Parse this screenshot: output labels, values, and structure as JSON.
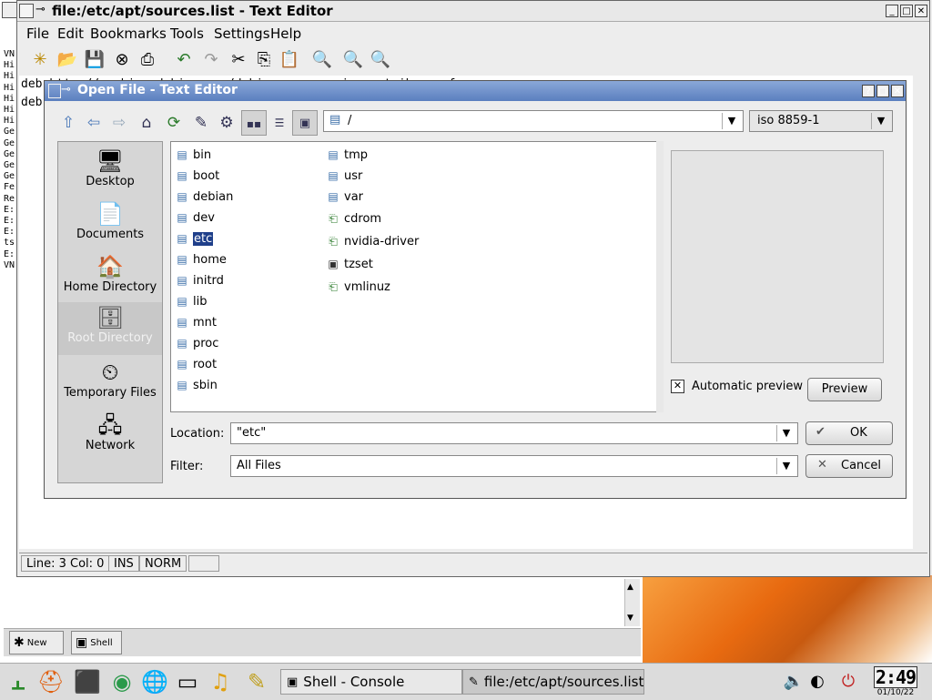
{
  "konsole": {
    "left_lines": "VN\nHi\nHi\nHi\nHi\nHi\nHi\nGe\nGe\nGe\nGe\nGe\nFe\nRe\nE:\nE:\nE:\nts\nE:\nVN",
    "tabs": [
      {
        "label": "New"
      },
      {
        "label": "Shell"
      }
    ]
  },
  "editor": {
    "title": "file:/etc/apt/sources.list - Text Editor",
    "menu": [
      "File",
      "Edit",
      "Bookmarks",
      "Tools",
      "Settings",
      "Help"
    ],
    "text_lines": [
      "deb http://archive.debian.org/debian sarge main contrib non-free",
      "deb"
    ],
    "status": {
      "position": "Line: 3 Col: 0",
      "mode": "INS",
      "norm": "NORM"
    }
  },
  "dialog": {
    "title": "Open File - Text Editor",
    "path": "/",
    "encoding": "iso 8859-1",
    "places": [
      {
        "label": "Desktop",
        "icon": "desktop-icon"
      },
      {
        "label": "Documents",
        "icon": "documents-icon"
      },
      {
        "label": "Home Directory",
        "icon": "home-directory-icon"
      },
      {
        "label": "Root Directory",
        "icon": "root-directory-icon"
      },
      {
        "label": "Temporary Files",
        "icon": "temporary-files-icon"
      },
      {
        "label": "Network",
        "icon": "network-icon"
      }
    ],
    "files_col1": [
      "bin",
      "boot",
      "debian",
      "dev",
      "etc",
      "home",
      "initrd",
      "lib",
      "mnt",
      "proc",
      "root",
      "sbin"
    ],
    "files_col2": [
      {
        "name": "tmp",
        "type": "folder"
      },
      {
        "name": "usr",
        "type": "folder"
      },
      {
        "name": "var",
        "type": "folder"
      },
      {
        "name": "cdrom",
        "type": "link"
      },
      {
        "name": "nvidia-driver",
        "type": "link"
      },
      {
        "name": "tzset",
        "type": "file"
      },
      {
        "name": "vmlinuz",
        "type": "link"
      }
    ],
    "selected_file": "etc",
    "auto_preview_label": "Automatic preview",
    "auto_preview_checked": true,
    "preview_button": "Preview",
    "location_label": "Location:",
    "location_value": "\"etc\"",
    "filter_label": "Filter:",
    "filter_value": "All Files",
    "ok_button": "OK",
    "cancel_button": "Cancel"
  },
  "taskbar": {
    "tasks": [
      {
        "label": "Shell - Console"
      },
      {
        "label": "file:/etc/apt/sources.list"
      }
    ],
    "clock_time": "2:49",
    "clock_date": "01/10/22"
  }
}
